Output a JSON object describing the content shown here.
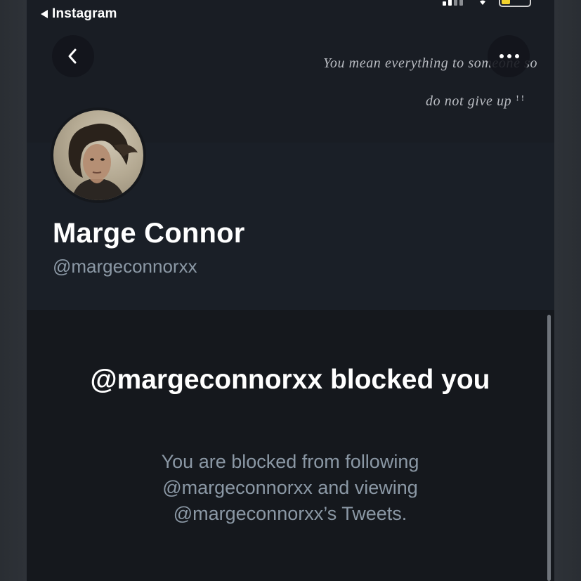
{
  "status_bar": {
    "back_app_label": "Instagram"
  },
  "header": {
    "banner_quote_line1": "You mean everything to someone so",
    "banner_quote_line2": "do not give up ☝︎☜"
  },
  "profile": {
    "display_name": "Marge Connor",
    "handle": "@margeconnorxx"
  },
  "blocked": {
    "title": "@margeconnorxx blocked you",
    "description": "You are blocked from following @margeconnorxx and viewing @margeconnorxx’s Tweets."
  },
  "icons": {
    "back": "chevron-left-icon",
    "more": "more-horizontal-icon",
    "status_back": "back-triangle-icon",
    "signal": "signal-icon",
    "wifi": "wifi-icon",
    "battery": "battery-icon"
  },
  "colors": {
    "background": "#15181d",
    "banner": "#191d24",
    "profile_bg": "#1a1f27",
    "secondary_text": "#8b98a5",
    "battery_fill": "#f2d22d"
  }
}
